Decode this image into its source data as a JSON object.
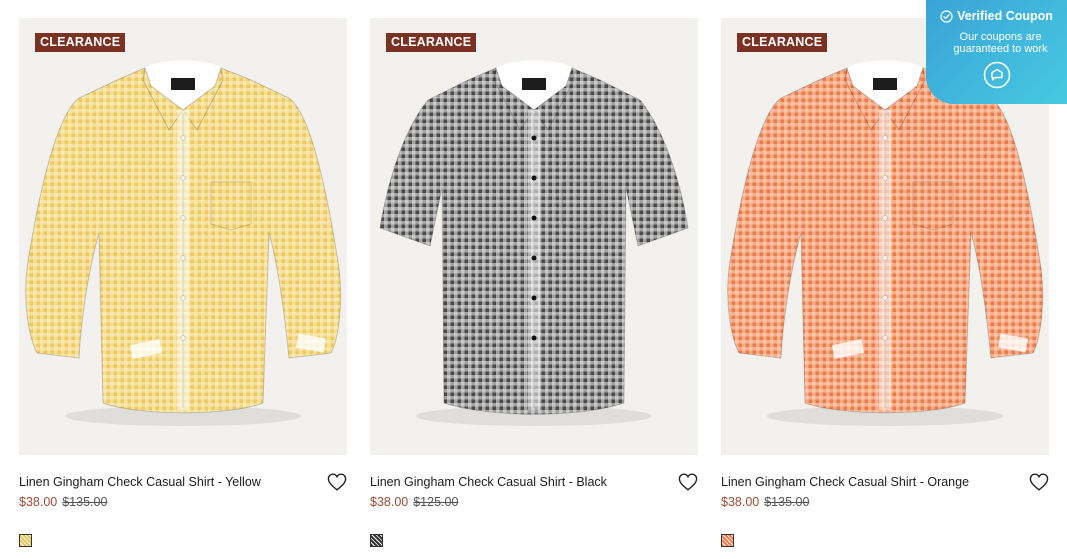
{
  "products": [
    {
      "badge": "CLEARANCE",
      "title": "Linen Gingham Check Casual Shirt - Yellow",
      "sale_price": "$38.00",
      "original_price": "$135.00",
      "shirt_color": "#f0c95a",
      "grid_color": "#fbf0cc",
      "sleeve": "long",
      "swatch_colors": [
        "#e8c25a",
        "#ffffff"
      ]
    },
    {
      "badge": "CLEARANCE",
      "title": "Linen Gingham Check Casual Shirt - Black",
      "sale_price": "$38.00",
      "original_price": "$125.00",
      "shirt_color": "#4a4a4a",
      "grid_color": "#e8e8e8",
      "sleeve": "short",
      "swatch_colors": [
        "#333333",
        "#ffffff"
      ]
    },
    {
      "badge": "CLEARANCE",
      "title": "Linen Gingham Check Casual Shirt - Orange",
      "sale_price": "$38.00",
      "original_price": "$135.00",
      "shirt_color": "#f07a45",
      "grid_color": "#fcd9c4",
      "sleeve": "long",
      "swatch_colors": [
        "#ee7a4a",
        "#ffffff"
      ]
    }
  ],
  "coupon": {
    "title": "Verified Coupon",
    "text": "Our coupons are guaranteed to work"
  },
  "icons": {
    "favorite": "heart-outline-icon",
    "verified": "check-circle-icon",
    "chat": "chat-bubble-icon"
  }
}
